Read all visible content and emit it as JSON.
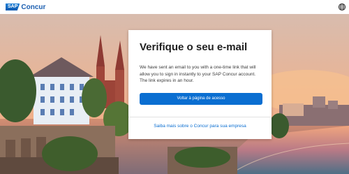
{
  "brand": {
    "logo_mark": "SAP",
    "product": "Concur"
  },
  "header": {
    "language_icon": "globe-icon"
  },
  "card": {
    "title": "Verifique o seu e-mail",
    "body": "We have sent an email to you with a one-time link that will allow you to sign in instantly to your SAP Concur account. The link expires in an hour.",
    "back_button_label": "Voltar à página de acesso",
    "learn_more_link": "Saiba mais sobre o Concur para sua empresa"
  },
  "colors": {
    "primary": "#0a6ed1",
    "brand_blue": "#1c5fb0"
  }
}
